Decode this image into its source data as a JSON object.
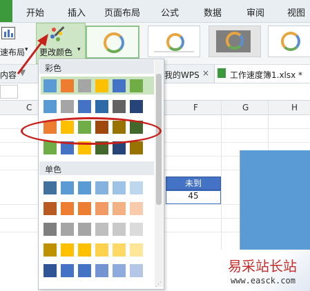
{
  "menu_tabs": [
    "开始",
    "插入",
    "页面布局",
    "公式",
    "数据",
    "审阅",
    "视图"
  ],
  "ribbon": {
    "layout_label": "速布局",
    "change_color_label": "更改颜色"
  },
  "file_tabs": {
    "wps_label": "我的WPS",
    "close_symbol": "×",
    "workbook_label": "工作速度簿1.xlsx *"
  },
  "toolbar": {
    "partial_label": "内容"
  },
  "columns": [
    "C",
    "F",
    "G",
    "H"
  ],
  "cells": {
    "header": "未到",
    "value": "45"
  },
  "dropdown": {
    "section_color": "彩色",
    "section_mono": "单色",
    "color_rows": [
      [
        "#5b9bd5",
        "#ed7d31",
        "#a5a5a5",
        "#ffc000",
        "#4472c4",
        "#70ad47"
      ],
      [
        "#5b9bd5",
        "#a5a5a5",
        "#4472c4",
        "#2e6aa8",
        "#636363",
        "#264478"
      ],
      [
        "#ed7d31",
        "#ffc000",
        "#70ad47",
        "#9e480e",
        "#997300",
        "#43682b"
      ],
      [
        "#70ad47",
        "#4472c4",
        "#ffc000",
        "#43682b",
        "#264478",
        "#997300"
      ]
    ],
    "mono_rows": [
      [
        "#41719c",
        "#5b9bd5",
        "#5b9bd5",
        "#84b3e0",
        "#9dc3e6",
        "#bdd7ee"
      ],
      [
        "#b85a21",
        "#ed7d31",
        "#ed7d31",
        "#f19a63",
        "#f4b183",
        "#f8cbad"
      ],
      [
        "#7f7f7f",
        "#a5a5a5",
        "#a5a5a5",
        "#bfbfbf",
        "#c9c9c9",
        "#dbdbdb"
      ],
      [
        "#bf9000",
        "#ffc000",
        "#ffc000",
        "#ffd24d",
        "#ffd966",
        "#ffe699"
      ],
      [
        "#2f5597",
        "#4472c4",
        "#4472c4",
        "#7493d3",
        "#8faadc",
        "#b4c7e7"
      ]
    ]
  },
  "watermark": {
    "title": "易采站长站",
    "url": "www.easck.com"
  }
}
